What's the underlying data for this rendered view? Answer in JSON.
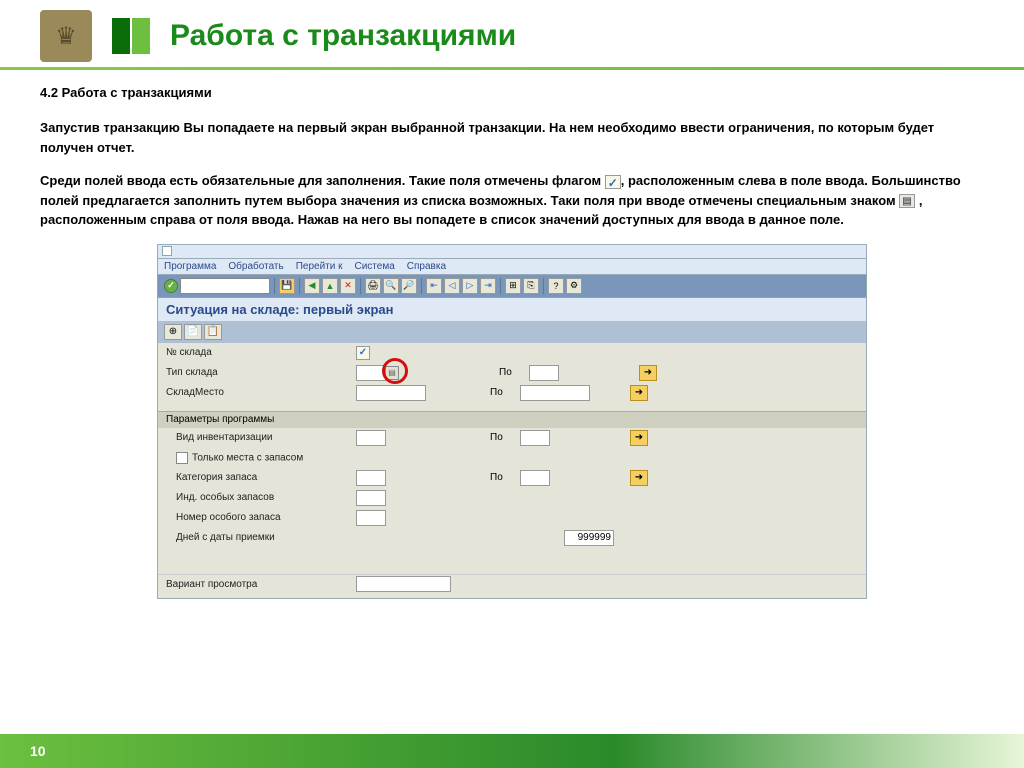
{
  "slide": {
    "title": "Работа с транзакциями",
    "section": "4.2 Работа с транзакциями",
    "p1": "Запустив транзакцию Вы попадаете на первый экран выбранной транзакции.  На нем необходимо ввести ограничения, по которым будет получен отчет.",
    "p2a": "Среди полей ввода есть обязательные для заполнения. Такие поля отмечены флагом",
    "p2b": ",  расположенным слева в поле ввода. Большинство полей предлагается заполнить путем выбора  значения из списка возможных. Таки поля при вводе отмечены специальным знаком",
    "p2c": " , расположенным справа от поля ввода. Нажав на него вы попадете в список значений доступных  для ввода в данное поле.",
    "page": "10"
  },
  "sap": {
    "menu": [
      "Программа",
      "Обработать",
      "Перейти к",
      "Система",
      "Справка"
    ],
    "screen_title": "Ситуация на складе: первый экран",
    "fields": {
      "warehouse_no": "№ склада",
      "warehouse_type": "Тип склада",
      "storage_bin": "СкладМесто",
      "po": "По",
      "group_params": "Параметры программы",
      "inv_type": "Вид инвентаризации",
      "only_stock": "Только места с запасом",
      "stock_cat": "Категория запаса",
      "special_ind": "Инд. особых запасов",
      "special_no": "Номер особого запаса",
      "days_since": "Дней с даты приемки",
      "days_val": "999999",
      "display_variant": "Вариант просмотра"
    }
  }
}
